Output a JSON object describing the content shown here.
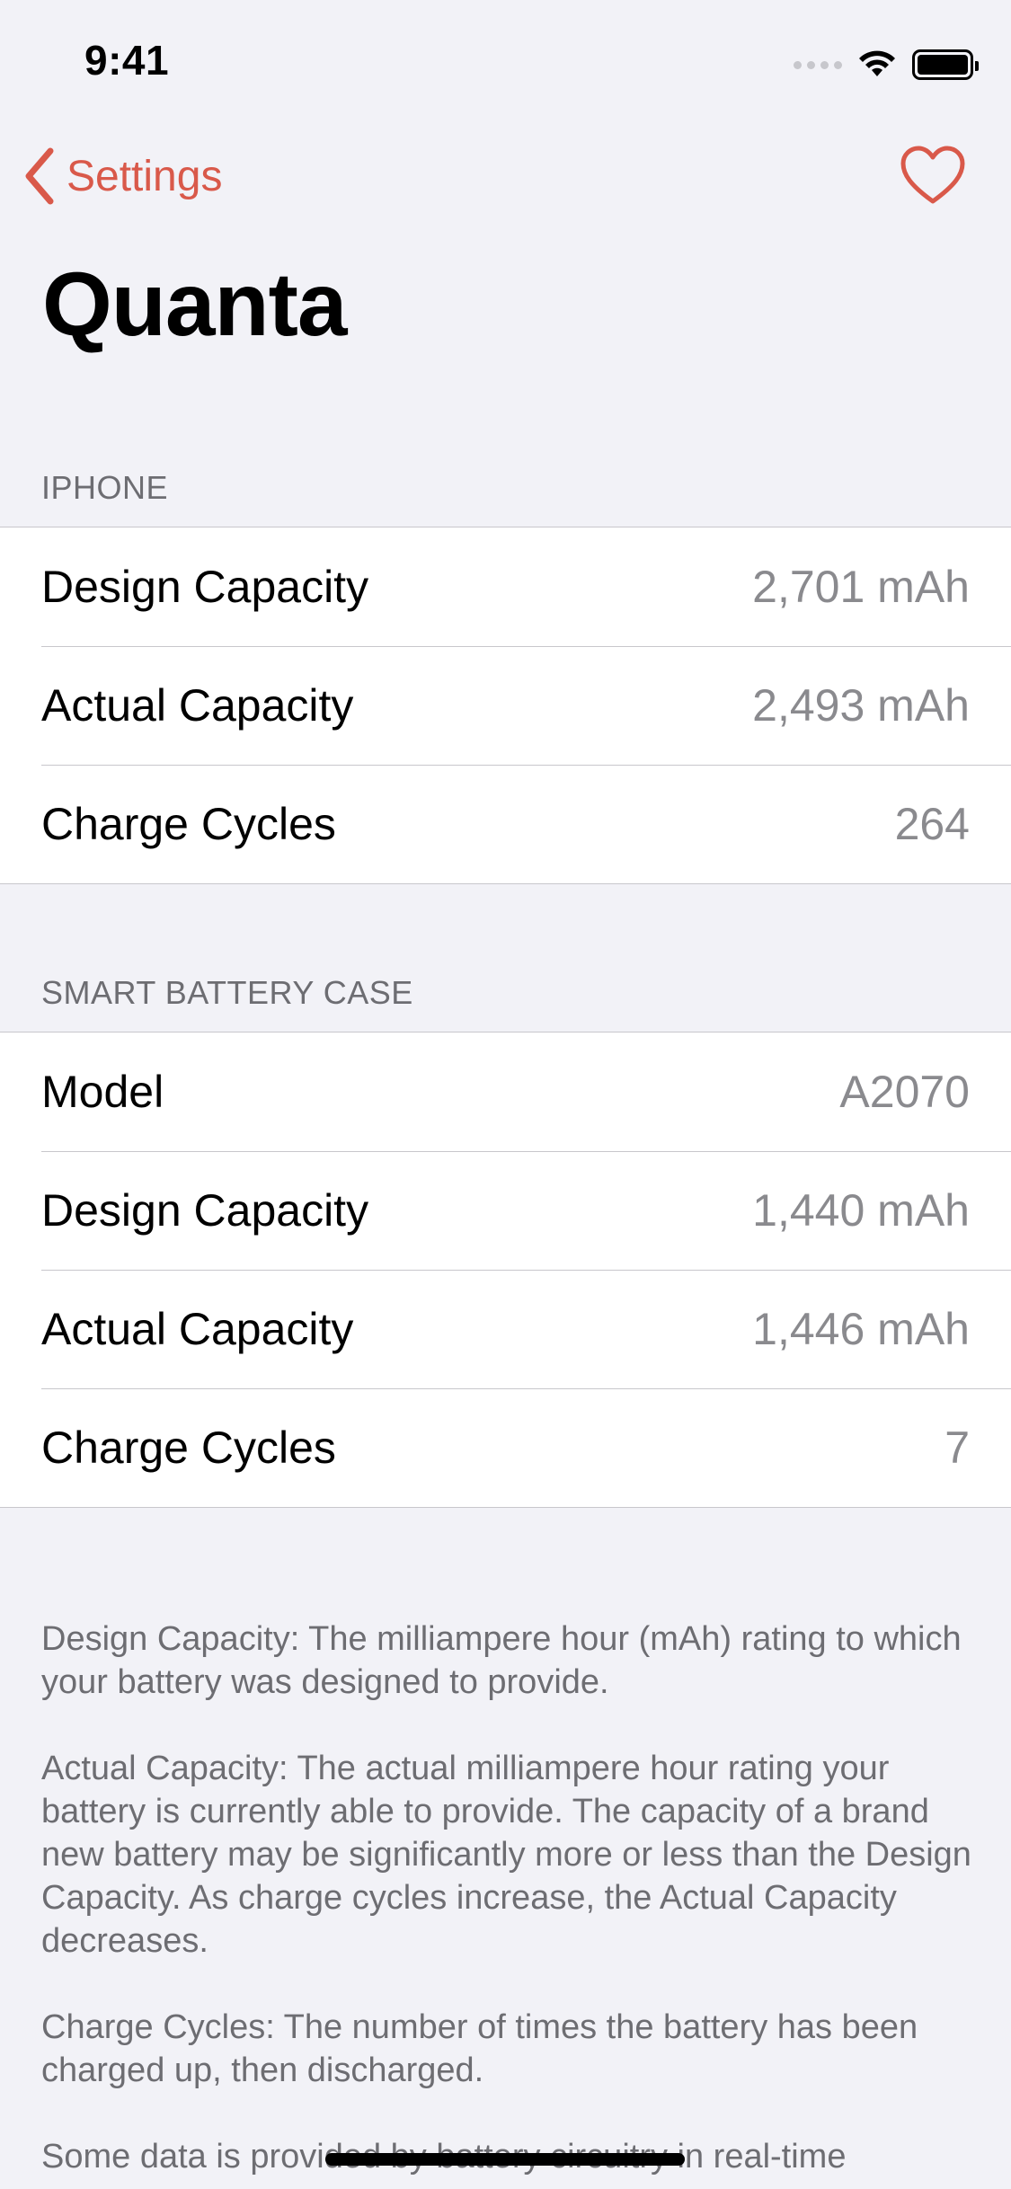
{
  "status_bar": {
    "time": "9:41"
  },
  "nav": {
    "back_label": "Settings"
  },
  "title": "Quanta",
  "iphone_section": {
    "header": "IPHONE",
    "rows": [
      {
        "label": "Design Capacity",
        "value": "2,701 mAh"
      },
      {
        "label": "Actual Capacity",
        "value": "2,493 mAh"
      },
      {
        "label": "Charge Cycles",
        "value": "264"
      }
    ]
  },
  "case_section": {
    "header": "SMART BATTERY CASE",
    "rows": [
      {
        "label": "Model",
        "value": "A2070"
      },
      {
        "label": "Design Capacity",
        "value": "1,440 mAh"
      },
      {
        "label": "Actual Capacity",
        "value": "1,446 mAh"
      },
      {
        "label": "Charge Cycles",
        "value": "7"
      }
    ]
  },
  "footer": {
    "paragraphs": [
      "Design Capacity: The milliampere hour (mAh) rating to which your battery was designed to provide.",
      "Actual Capacity: The actual milliampere hour rating your battery is currently able to provide. The capacity of a brand new battery may be significantly more or less than the Design Capacity. As charge cycles increase, the Actual Capacity decreases.",
      "Charge Cycles: The number of times the battery has been charged up, then discharged.",
      "Some data is provided by battery circuitry in real-time"
    ]
  },
  "colors": {
    "accent": "#d9594a",
    "background": "#f2f2f7",
    "secondary_text": "#8a8a8e"
  },
  "icons": [
    "wifi-icon",
    "battery-icon",
    "chevron-left-icon",
    "heart-icon"
  ]
}
